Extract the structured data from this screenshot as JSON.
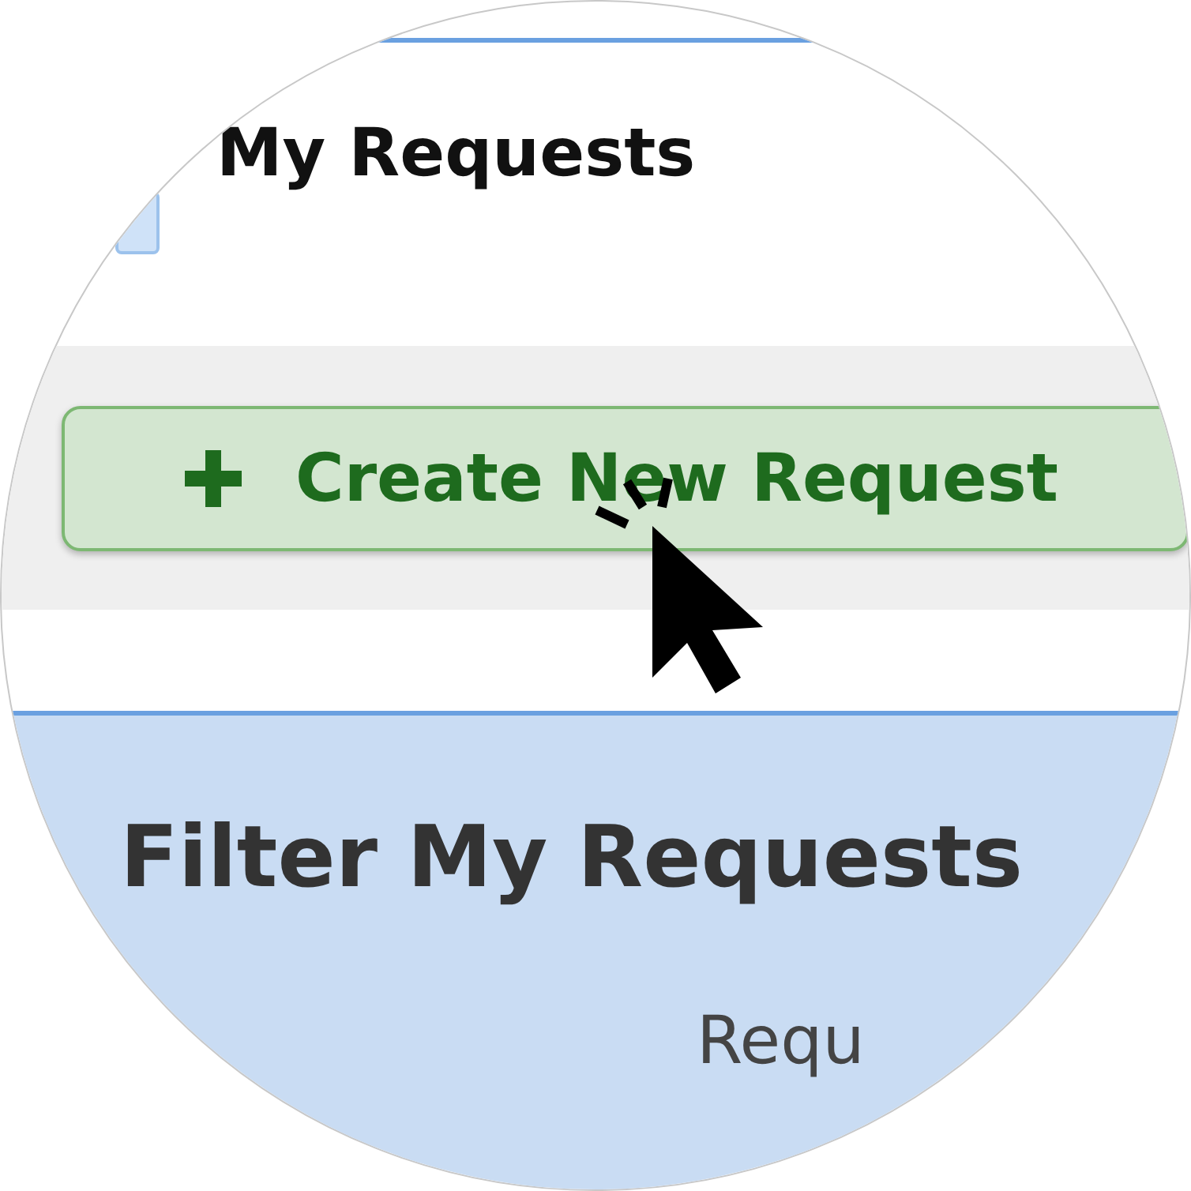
{
  "header": {
    "title": "My Requests"
  },
  "toolbar": {
    "create_button": {
      "label": "Create New Request"
    }
  },
  "filter_panel": {
    "title": "Filter My Requests",
    "field_label": "Requ"
  }
}
